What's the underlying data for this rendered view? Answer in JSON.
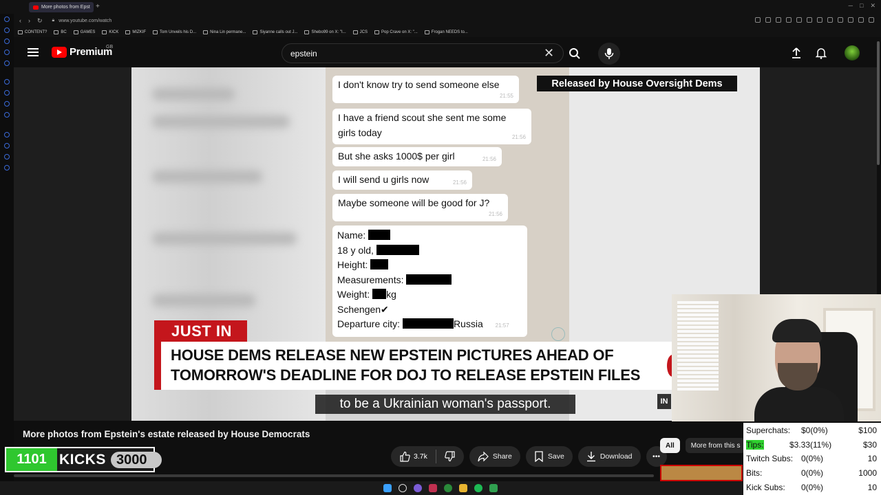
{
  "browser": {
    "tab_title": "More photos from Epst",
    "url": "www.youtube.com/watch",
    "bookmarks": [
      "CONTENT?",
      "BC",
      "GAMES",
      "KICK",
      "MIZKIF",
      "Tom Unveils his D...",
      "Nina Lin permane...",
      "Siyanne calls out J...",
      "Shebo99 on X: \"I...",
      "JCS",
      "Pop Crave on X: \"...",
      "Frogan NEEDS to..."
    ]
  },
  "header": {
    "logo_text": "Premium",
    "region": "GB",
    "search_value": "epstein",
    "icons": [
      "menu-icon",
      "search-icon",
      "mic-icon",
      "upload-icon",
      "bell-icon"
    ]
  },
  "video": {
    "banner": "Released by House Oversight Dems",
    "messages": [
      {
        "text": "I don't know try to send someone else",
        "time": "21:55"
      },
      {
        "text": "I have a friend scout she sent me some girls today",
        "time": "21:56"
      },
      {
        "text": "But she asks 1000$  per girl",
        "time": "21:56"
      },
      {
        "text": "I will send u girls now",
        "time": "21:56"
      },
      {
        "text": "Maybe someone will be good for J?",
        "time": "21:56"
      }
    ],
    "info_lines": {
      "name": "Name:",
      "age": "18 y old,",
      "height": "Height:",
      "measurements": "Measurements:",
      "weight": "Weight:",
      "weight_unit": "kg",
      "schengen": "Schengen✔",
      "departure": "Departure city:",
      "departure_country": "Russia",
      "time": "21:57"
    },
    "just_in": "JUST IN",
    "headline_line1": "HOUSE DEMS RELEASE NEW EPSTEIN PICTURES AHEAD OF",
    "headline_line2": "TOMORROW'S DEADLINE FOR DOJ TO RELEASE EPSTEIN FILES",
    "in_tag": "IN",
    "caption": "to be a Ukrainian woman's passport."
  },
  "below_video": {
    "title": "More photos from Epstein's estate released by House Democrats",
    "likes": "3.7k",
    "share": "Share",
    "save": "Save",
    "download": "Download",
    "chips": [
      "All",
      "More from this s"
    ]
  },
  "kicks_widget": {
    "count": "1101",
    "label": "KICKS",
    "goal": "3000",
    "progress": 0.367
  },
  "stats": [
    {
      "label": "Superchats:",
      "value": "$0(0%)",
      "goal": "$100"
    },
    {
      "label": "Tips:",
      "value": "$3.33(11%)",
      "goal": "$30"
    },
    {
      "label": "Twitch Subs:",
      "value": "0(0%)",
      "goal": "10"
    },
    {
      "label": "Bits:",
      "value": "0(0%)",
      "goal": "1000"
    },
    {
      "label": "Kick Subs:",
      "value": "0(0%)",
      "goal": "10"
    }
  ],
  "colors": {
    "yt_red": "#ff0000",
    "cnn_red": "#c4161c",
    "kicks_green": "#2fc72f"
  }
}
